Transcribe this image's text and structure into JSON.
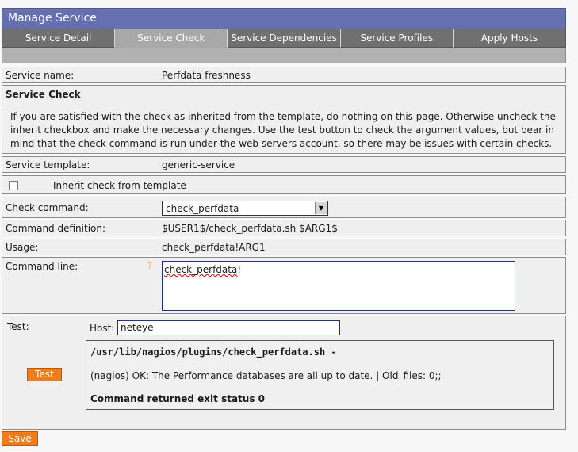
{
  "title": "Manage Service",
  "tabs": [
    {
      "label": "Service Detail"
    },
    {
      "label": "Service Check"
    },
    {
      "label": "Service Dependencies"
    },
    {
      "label": "Service Profiles"
    },
    {
      "label": "Apply Hosts"
    }
  ],
  "active_tab": "Service Check",
  "service_name": {
    "label": "Service name:",
    "value": "Perfdata freshness"
  },
  "service_check": {
    "heading": "Service Check",
    "description": "If you are satisfied with the check as inherited from the template, do nothing on this page. Otherwise uncheck the inherit checkbox and make the necessary changes. Use the test button to check the argument values, but bear in mind that the check command is run under the web servers account, so there may be issues with certain checks."
  },
  "service_template": {
    "label": "Service template:",
    "value": "generic-service"
  },
  "inherit": {
    "label": "Inherit check from template",
    "checked": false
  },
  "check_command": {
    "label": "Check command:",
    "value": "check_perfdata"
  },
  "command_definition": {
    "label": "Command definition:",
    "value": "$USER1$/check_perfdata.sh $ARG1$"
  },
  "usage": {
    "label": "Usage:",
    "value": "check_perfdata!ARG1"
  },
  "command_line": {
    "label": "Command line:",
    "help": "?",
    "value_misspelled": "check_perfdata",
    "value_suffix": "!"
  },
  "test": {
    "label": "Test:",
    "host_label": "Host:",
    "host_value": "neteye",
    "button": "Test",
    "output_command": "/usr/lib/nagios/plugins/check_perfdata.sh -",
    "output_result": "(nagios) OK: The Performance databases are all up to date. | Old_files: 0;;",
    "output_status": "Command returned exit status 0"
  },
  "save_button": "Save",
  "colors": {
    "title_bar": "#6670b0",
    "button": "#f07d1a",
    "active_tab": "#a8a8a8"
  }
}
